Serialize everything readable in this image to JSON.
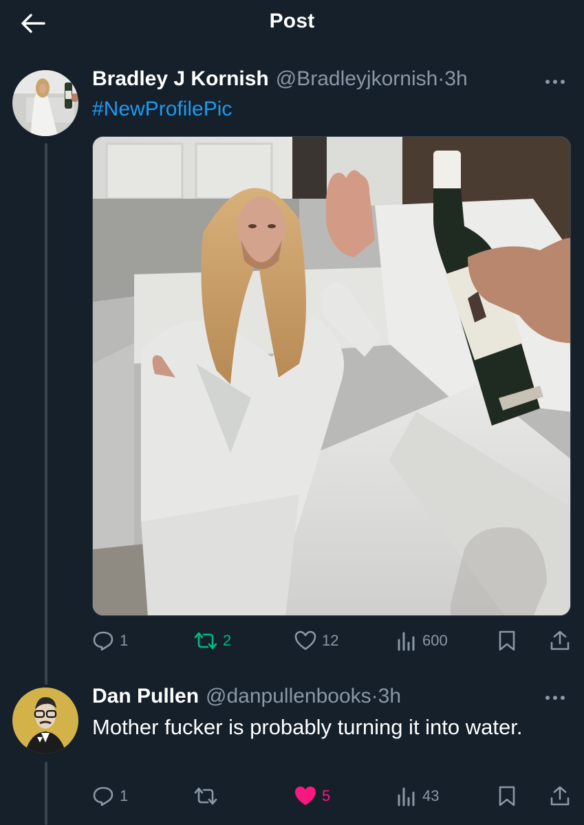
{
  "header": {
    "title": "Post"
  },
  "post": {
    "author_name": "Bradley J Kornish",
    "handle_time": "@Bradleyjkornish·3h",
    "hashtag": "#NewProfilePic",
    "stats": {
      "replies": "1",
      "reposts": "2",
      "likes": "12",
      "views": "600"
    }
  },
  "reply": {
    "author_name": "Dan Pullen",
    "handle_time": "@danpullenbooks·3h",
    "text": "Mother fucker is probably turning it into water.",
    "stats": {
      "replies": "1",
      "reposts": "",
      "likes": "5",
      "views": "43"
    }
  },
  "colors": {
    "background": "#15202b",
    "accent_blue": "#1d9bf0",
    "repost_green": "#00ba7c",
    "like_pink": "#f91880",
    "muted": "#8b98a5"
  },
  "icons": [
    "back-arrow-icon",
    "more-dots-icon",
    "reply-icon",
    "repost-icon",
    "heart-icon",
    "views-icon",
    "bookmark-icon",
    "share-icon"
  ]
}
